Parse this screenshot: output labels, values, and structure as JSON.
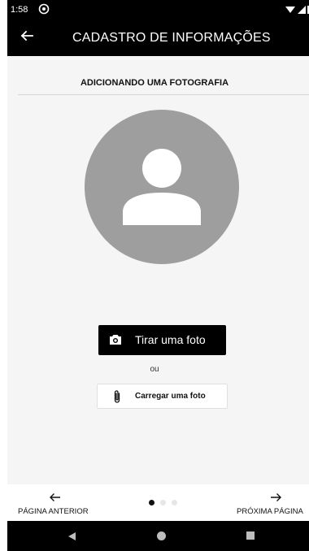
{
  "status_bar": {
    "time": "1:58",
    "sync_icon": "sync-icon",
    "wifi_icon": "wifi-icon",
    "signal_icon": "signal-icon"
  },
  "toolbar": {
    "back_icon": "arrow-left-icon",
    "title": "CADASTRO DE INFORMAÇÕES"
  },
  "main": {
    "section_title": "ADICIONANDO UMA FOTOGRAFIA",
    "avatar_icon": "person-placeholder-icon",
    "take_photo_label": "Tirar uma foto",
    "or_label": "ou",
    "upload_photo_label": "Carregar uma foto"
  },
  "bottom_nav": {
    "prev_label": "PÁGINA ANTERIOR",
    "next_label": "PRÓXIMA PÁGINA",
    "page_indicator": {
      "total": 3,
      "active": 1
    }
  },
  "colors": {
    "bar": "#000000",
    "avatar": "#9e9e9e",
    "background": "#f5f5f5"
  }
}
